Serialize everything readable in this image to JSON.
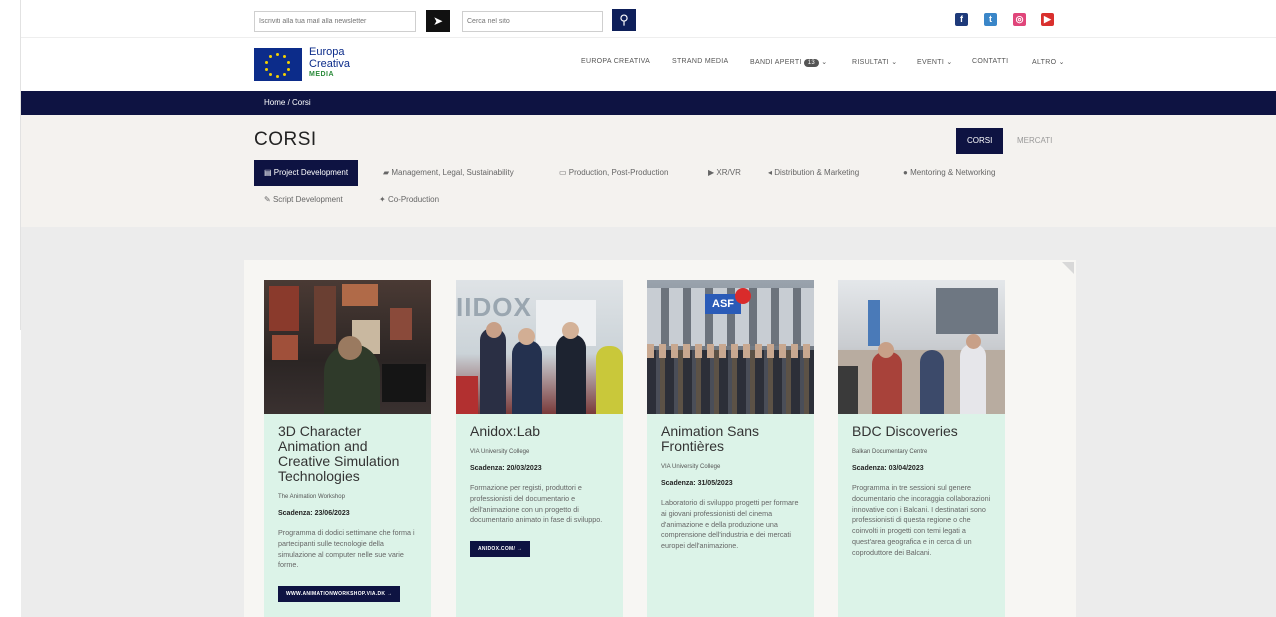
{
  "topbar": {
    "newsletter_placeholder": "Iscriviti alla tua mail alla newsletter",
    "search_placeholder": "Cerca nel sito",
    "social": [
      {
        "icon": "facebook-icon",
        "color": "#1e3a7a"
      },
      {
        "icon": "twitter-icon",
        "color": "#3a86c8"
      },
      {
        "icon": "instagram-icon",
        "color": "#e0457a"
      },
      {
        "icon": "youtube-icon",
        "color": "#d9302e"
      }
    ]
  },
  "logo": {
    "line1": "Europa",
    "line2": "Creativa",
    "line3": "MEDIA"
  },
  "nav": {
    "items": [
      "EUROPA CREATIVA",
      "STRAND MEDIA",
      "BANDI APERTI",
      "RISULTATI",
      "EVENTI",
      "CONTATTI",
      "ALTRO"
    ],
    "badge": "13",
    "chevron": "⌄"
  },
  "breadcrumb": {
    "text": "Home  /  Corsi"
  },
  "page": {
    "title": "CORSI",
    "toggle_on": "CORSI",
    "toggle_off": "MERCATI"
  },
  "tabs": [
    {
      "label": "Project Development",
      "icon": "▤"
    },
    {
      "label": "Management, Legal, Sustainability",
      "icon": "▰"
    },
    {
      "label": "Production, Post-Production",
      "icon": "▭"
    },
    {
      "label": "XR/VR",
      "icon": "▶"
    },
    {
      "label": "Distribution & Marketing",
      "icon": "◂"
    },
    {
      "label": "Mentoring & Networking",
      "icon": "●"
    },
    {
      "label": "Script Development",
      "icon": "✎"
    },
    {
      "label": "Co-Production",
      "icon": "✦"
    }
  ],
  "cards": [
    {
      "title": "3D Character Animation and Creative Simulation Technologies",
      "org": "The Animation Workshop",
      "deadline": "Scadenza: 23/06/2023",
      "desc": "Programma di dodici settimane che forma i partecipanti sulle tecnologie della simulazione al computer nelle sue varie forme.",
      "button": "WWW.ANIMATIONWORKSHOP.VIA.DK →"
    },
    {
      "title": "Anidox:Lab",
      "org": "VIA University College",
      "deadline": "Scadenza: 20/03/2023",
      "desc": "Formazione per registi, produttori e professionisti del documentario e dell'animazione con un progetto di documentario animato in fase di sviluppo.",
      "button": "ANIDOX.COM/ →",
      "img_label": "IIDOX"
    },
    {
      "title": "Animation Sans Frontières",
      "org": "VIA University College",
      "deadline": "Scadenza: 31/05/2023",
      "desc": "Laboratorio di sviluppo progetti per formare ai giovani professionisti del cinema d'animazione e della produzione una comprensione dell'industria e dei mercati europei dell'animazione.",
      "button": "",
      "img_label": "ASF"
    },
    {
      "title": "BDC Discoveries",
      "org": "Balkan Documentary Centre",
      "deadline": "Scadenza: 03/04/2023",
      "desc": "Programma in tre sessioni sul genere documentario che incoraggia collaborazioni innovative con i Balcani. I destinatari sono professionisti di questa regione o che coinvolti in progetti con temi legati a quest'area geografica e in cerca di un coproduttore dei Balcani.",
      "button": ""
    }
  ]
}
